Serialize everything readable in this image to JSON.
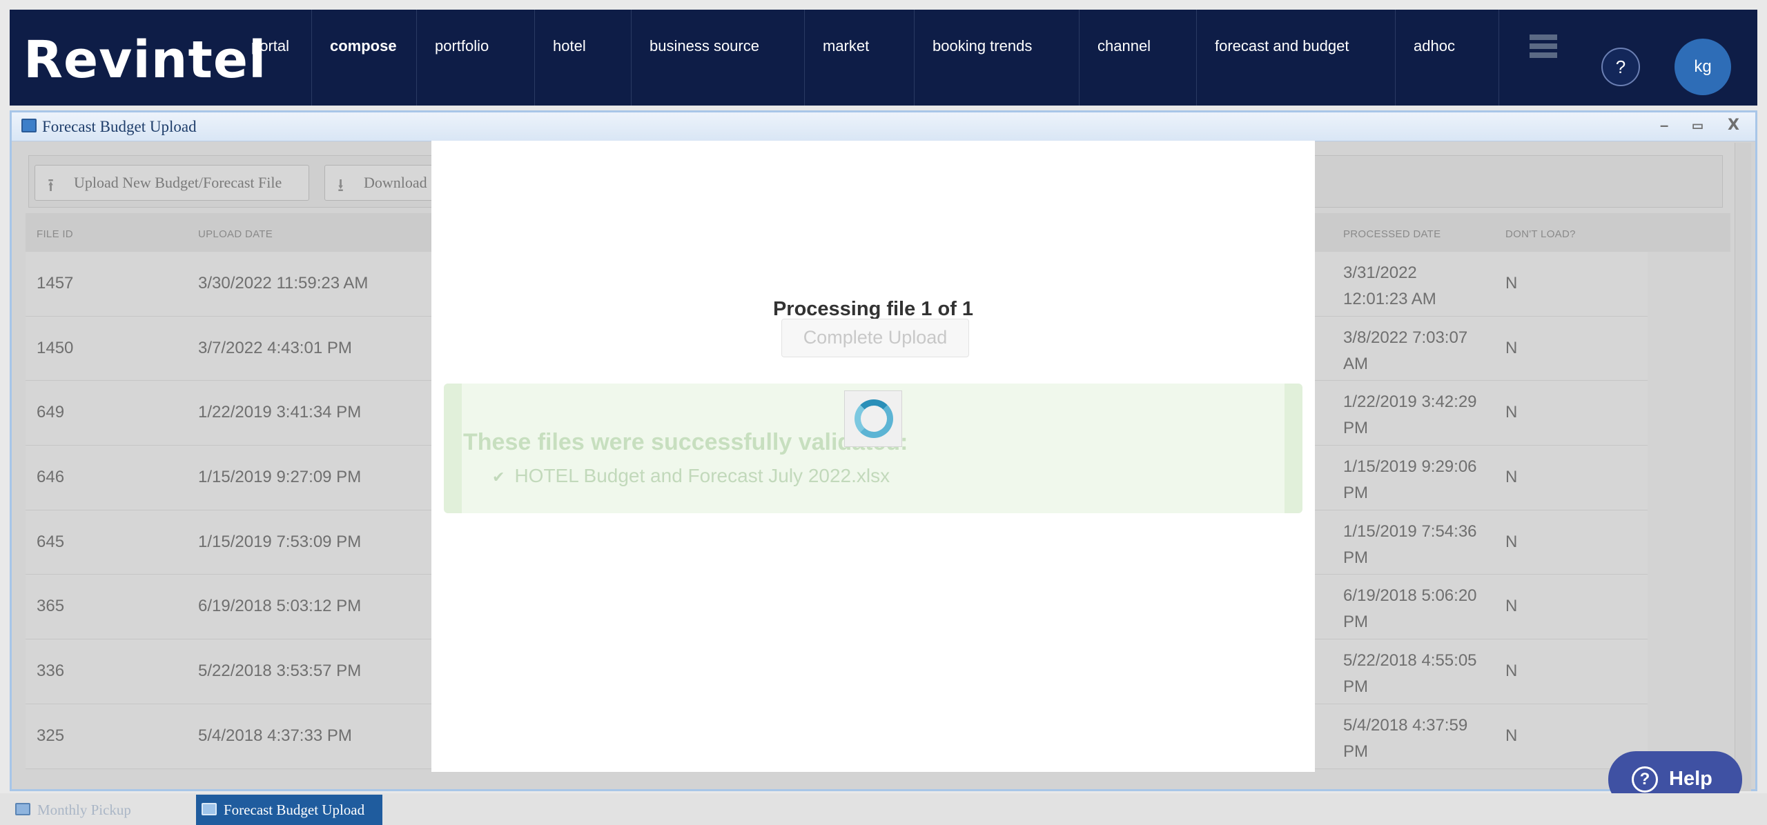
{
  "app": {
    "logo": "Revintel",
    "nav": [
      "portal",
      "compose",
      "portfolio",
      "hotel",
      "business source",
      "market",
      "booking trends",
      "channel",
      "forecast and budget",
      "adhoc"
    ],
    "active_nav": "compose",
    "help_icon_label": "?",
    "avatar_initials": "kg"
  },
  "window": {
    "title": "Forecast Budget Upload",
    "controls": [
      "–",
      "▭",
      "X"
    ],
    "toolbar": {
      "upload_label": "Upload New Budget/Forecast File",
      "download_label": "Download"
    },
    "table": {
      "headers": {
        "file_id": "FILE ID",
        "upload_date": "UPLOAD DATE",
        "processed_date": "PROCESSED DATE",
        "dont_load": "DON'T LOAD?"
      },
      "rows": [
        {
          "file_id": "1457",
          "upload_date": "3/30/2022 11:59:23 AM",
          "processed_date": "3/31/2022 12:01:23 AM",
          "dont_load": "N"
        },
        {
          "file_id": "1450",
          "upload_date": "3/7/2022 4:43:01 PM",
          "processed_date": "3/8/2022 7:03:07 AM",
          "dont_load": "N"
        },
        {
          "file_id": "649",
          "upload_date": "1/22/2019 3:41:34 PM",
          "processed_date": "1/22/2019 3:42:29 PM",
          "dont_load": "N"
        },
        {
          "file_id": "646",
          "upload_date": "1/15/2019 9:27:09 PM",
          "processed_date": "1/15/2019 9:29:06 PM",
          "dont_load": "N"
        },
        {
          "file_id": "645",
          "upload_date": "1/15/2019 7:53:09 PM",
          "processed_date": "1/15/2019 7:54:36 PM",
          "dont_load": "N"
        },
        {
          "file_id": "365",
          "upload_date": "6/19/2018 5:03:12 PM",
          "processed_date": "6/19/2018 5:06:20 PM",
          "dont_load": "N"
        },
        {
          "file_id": "336",
          "upload_date": "5/22/2018 3:53:57 PM",
          "processed_date": "5/22/2018 4:55:05 PM",
          "dont_load": "N"
        },
        {
          "file_id": "325",
          "upload_date": "5/4/2018 4:37:33 PM",
          "processed_date": "5/4/2018 4:37:59 PM",
          "dont_load": "N"
        }
      ]
    }
  },
  "modal": {
    "processing_text": "Processing file 1 of 1",
    "complete_button": "Complete Upload",
    "success_title": "These files were successfully validated:",
    "file_name": "HOTEL Budget and Forecast July 2022.xlsx"
  },
  "help_button": "Help",
  "taskbar": [
    "Monthly Pickup",
    "Forecast Budget Upload"
  ],
  "colors": {
    "nav_bg": "#0e1d47",
    "avatar": "#2e6db7",
    "help_button": "#3f51a3",
    "active_task": "#1f5c9e"
  }
}
